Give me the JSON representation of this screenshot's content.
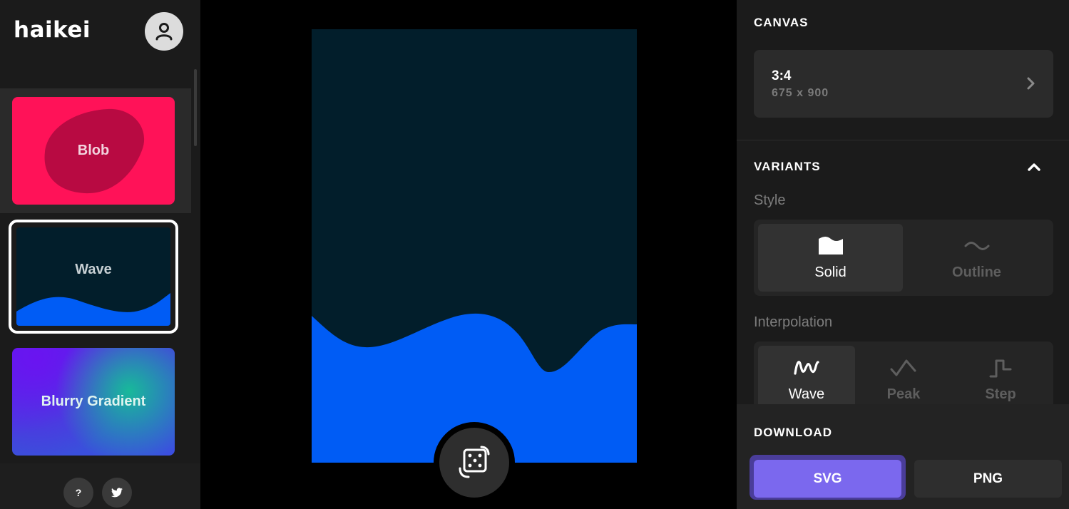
{
  "app": {
    "logo": "haikei"
  },
  "sidebar": {
    "cards": [
      {
        "label": "Blob",
        "color": "#ff1258"
      },
      {
        "label": "Wave",
        "color": "#021e2b",
        "selected": true
      },
      {
        "label": "Blurry Gradient"
      }
    ],
    "footer": {
      "help_label": "?",
      "twitter_icon": "twitter-icon"
    }
  },
  "canvas": {
    "background": "#021e2b",
    "wave_color": "#005cf5"
  },
  "panel": {
    "canvas_section": {
      "title": "CANVAS",
      "ratio": "3:4",
      "dimensions": "675 x 900"
    },
    "variants_section": {
      "title": "VARIANTS",
      "style_label": "Style",
      "style_options": [
        {
          "label": "Solid",
          "icon": "solid-icon",
          "active": true
        },
        {
          "label": "Outline",
          "icon": "outline-icon",
          "active": false
        }
      ],
      "interpolation_label": "Interpolation",
      "interpolation_options": [
        {
          "label": "Wave",
          "icon": "wave-icon",
          "active": true
        },
        {
          "label": "Peak",
          "icon": "peak-icon",
          "active": false
        },
        {
          "label": "Step",
          "icon": "step-icon",
          "active": false
        }
      ]
    },
    "download_section": {
      "title": "DOWNLOAD",
      "svg_label": "SVG",
      "png_label": "PNG",
      "accent": "#7b68ee"
    }
  }
}
